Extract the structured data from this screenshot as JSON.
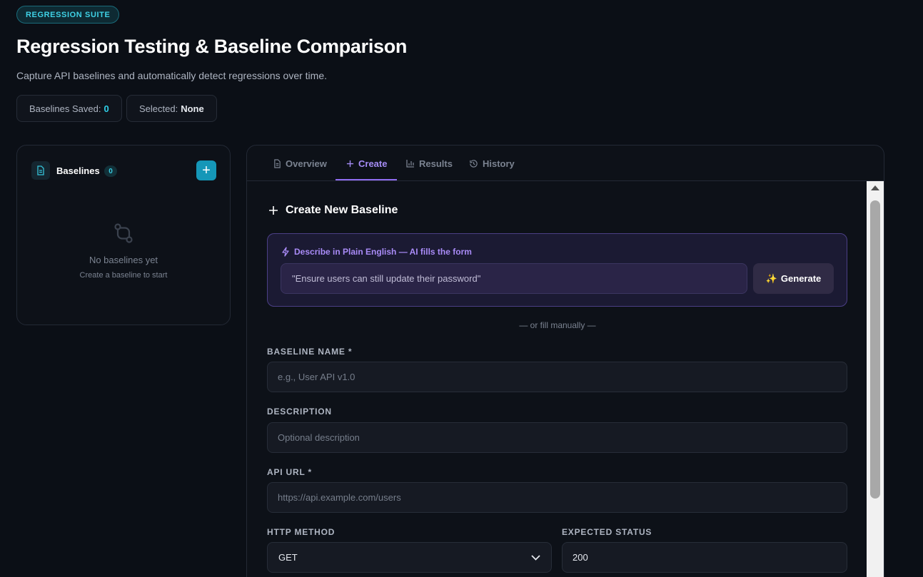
{
  "header": {
    "badge": "REGRESSION SUITE",
    "title": "Regression Testing & Baseline Comparison",
    "subtitle": "Capture API baselines and automatically detect regressions over time."
  },
  "stats": {
    "baselines_saved_label": "Baselines Saved:",
    "baselines_saved_value": "0",
    "selected_label": "Selected:",
    "selected_value": "None"
  },
  "sidebar": {
    "title": "Baselines",
    "count": "0",
    "add_label": "+",
    "empty_title": "No baselines yet",
    "empty_subtitle": "Create a baseline to start"
  },
  "tabs": [
    {
      "label": "Overview",
      "icon": "document-icon"
    },
    {
      "label": "Create",
      "icon": "plus-icon",
      "active": true
    },
    {
      "label": "Results",
      "icon": "bar-chart-icon"
    },
    {
      "label": "History",
      "icon": "history-icon"
    }
  ],
  "create": {
    "section_title": "Create New Baseline",
    "ai_label": "Describe in Plain English — AI fills the form",
    "ai_placeholder": "\"Ensure users can still update their password\"",
    "generate_label": "Generate",
    "or_manual": "— or fill manually —",
    "name_label": "BASELINE NAME *",
    "name_placeholder": "e.g., User API v1.0",
    "description_label": "DESCRIPTION",
    "description_placeholder": "Optional description",
    "url_label": "API URL *",
    "url_placeholder": "https://api.example.com/users",
    "method_label": "HTTP METHOD",
    "method_value": "GET",
    "status_label": "EXPECTED STATUS",
    "status_value": "200"
  },
  "colors": {
    "accent_cyan": "#2fd0e8",
    "accent_purple": "#a58cf5",
    "background": "#0b0f16"
  }
}
